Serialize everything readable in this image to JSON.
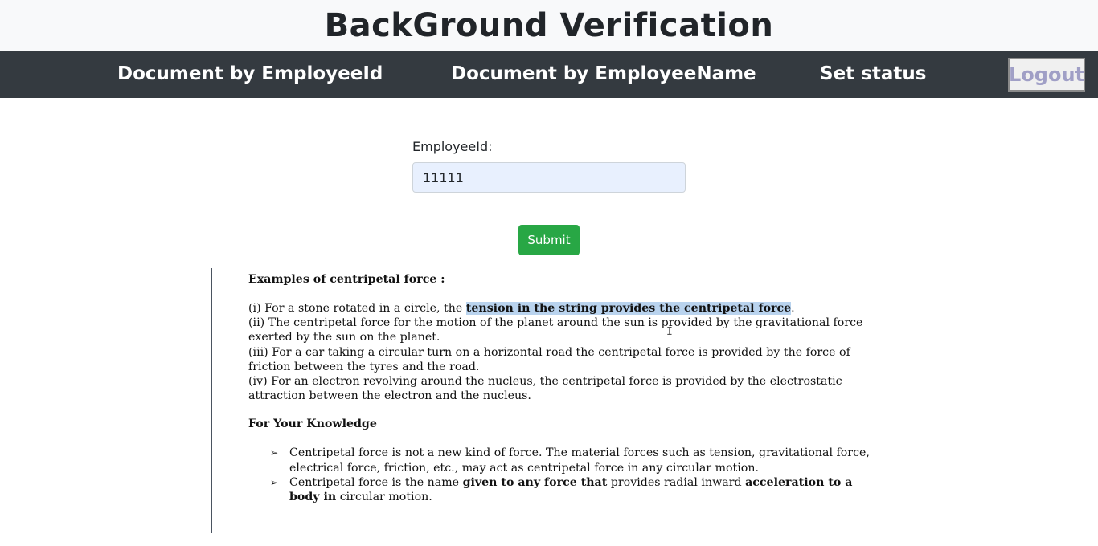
{
  "header": {
    "title": "BackGround Verification"
  },
  "nav": {
    "by_id": "Document by EmployeeId",
    "by_name": "Document by EmployeeName",
    "set_status": "Set status",
    "logout": "Logout"
  },
  "form": {
    "label": "EmployeeId:",
    "value": "11111",
    "submit": "Submit"
  },
  "document": {
    "heading": "Examples of centripetal force :",
    "item1_prefix": "(i) For a stone rotated in a circle, the ",
    "item1_highlight": "tension in the string provides the centripetal force",
    "item1_suffix": ".",
    "item2": "(ii) The centripetal force for the motion of the planet around the sun is provided by the gravitational force exerted by the sun on the planet.",
    "item3": "(iii) For a car taking a circular turn on a horizontal road the centripetal force is provided by the force of friction between the tyres and the road.",
    "item4": "(iv) For an electron revolving around the nucleus, the centripetal force is provided by the electrostatic attraction between the electron and the nucleus.",
    "knowledge_heading": "For Your Knowledge",
    "bullet_symbol": "➢",
    "bullet1": "Centripetal force is not a new kind of force. The material forces such as tension, gravitational force, electrical force, friction, etc., may act as centripetal force in any circular motion.",
    "bullet2_a": "Centripetal force is the name ",
    "bullet2_b": "given to any force that",
    "bullet2_c": " provides radial inward ",
    "bullet2_d": "acceleration to a body in",
    "bullet2_e": " circular motion."
  }
}
